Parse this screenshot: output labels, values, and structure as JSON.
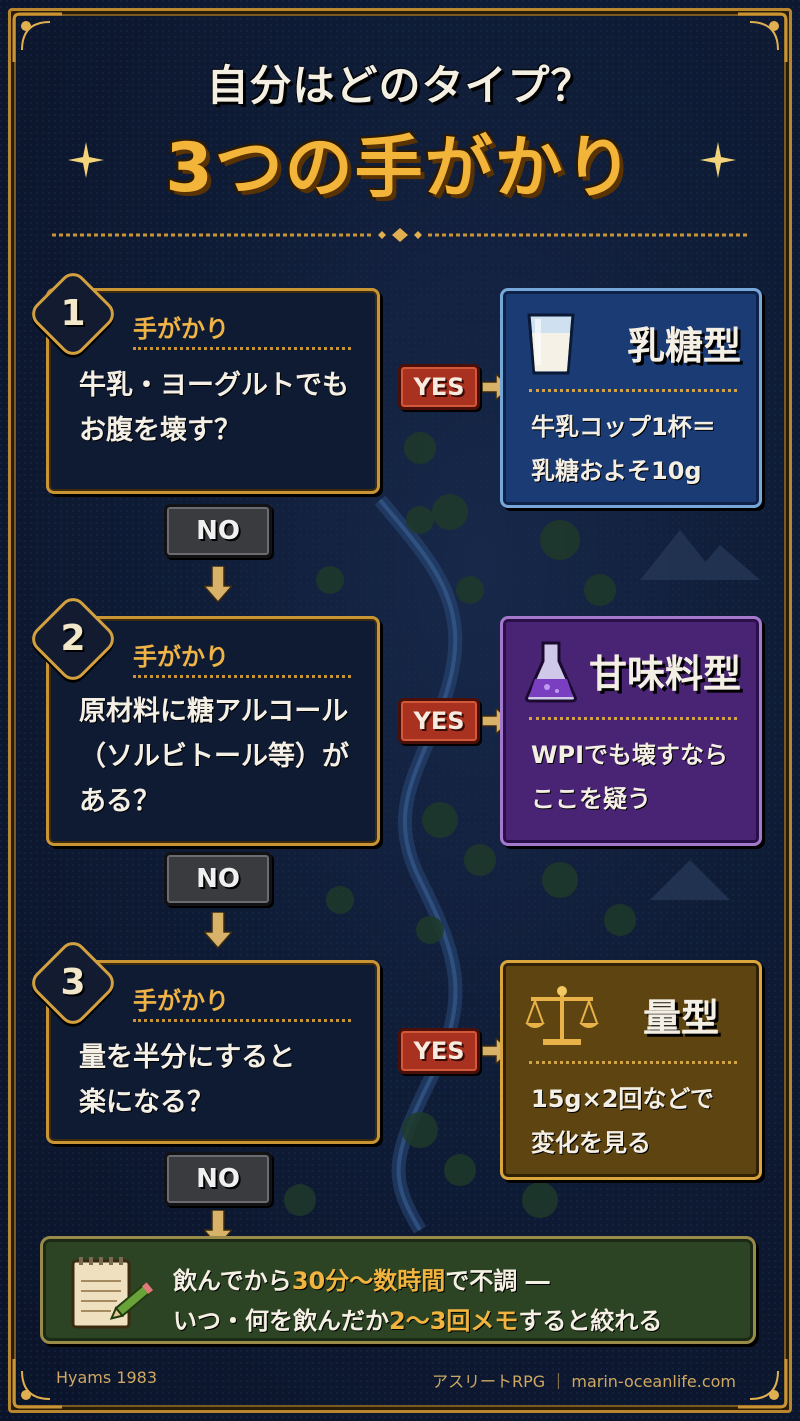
{
  "header": {
    "subtitle": "自分はどのタイプ？",
    "title": "3つの手がかり"
  },
  "steps": [
    {
      "number": "1",
      "label": "手がかり",
      "question_lines": [
        "牛乳・ヨーグルトでも",
        "お腹を壊す？"
      ],
      "yes_label": "YES",
      "no_label": "NO",
      "result": {
        "title": "乳糖型",
        "icon": "milk-glass-icon",
        "lines": [
          "牛乳コップ1杯＝",
          "乳糖およそ10g"
        ],
        "color": "#1b3b74"
      }
    },
    {
      "number": "2",
      "label": "手がかり",
      "question_lines": [
        "原材料に糖アルコール",
        "（ソルビトール等）が",
        "ある？"
      ],
      "yes_label": "YES",
      "no_label": "NO",
      "result": {
        "title": "甘味料型",
        "icon": "flask-icon",
        "lines": [
          "WPIでも壊すなら",
          "ここを疑う"
        ],
        "color": "#4a2474"
      }
    },
    {
      "number": "3",
      "label": "手がかり",
      "question_lines": [
        "量を半分にすると",
        "楽になる？"
      ],
      "yes_label": "YES",
      "no_label": "NO",
      "result": {
        "title": "量型",
        "icon": "scale-icon",
        "lines": [
          "15g×2回などで",
          "変化を見る"
        ],
        "color": "#5e4410"
      }
    }
  ],
  "note": {
    "icon": "notepad-pencil-icon",
    "line1_a": "飲んでから",
    "line1_hl": "30分〜数時間",
    "line1_b": "で不調 ―",
    "line2_a": "いつ・何を飲んだか",
    "line2_hl": "2〜3回メモ",
    "line2_b": "すると絞れる"
  },
  "footer": {
    "source": "Hyams 1983",
    "credit": "アスリートRPG ｜ marin-oceanlife.com"
  },
  "colors": {
    "gold": "#c99434",
    "title_gold": "#f2b53a",
    "yes_red": "#a8321f",
    "no_gray": "#3a3b3f",
    "navy": "#0f1a33"
  }
}
